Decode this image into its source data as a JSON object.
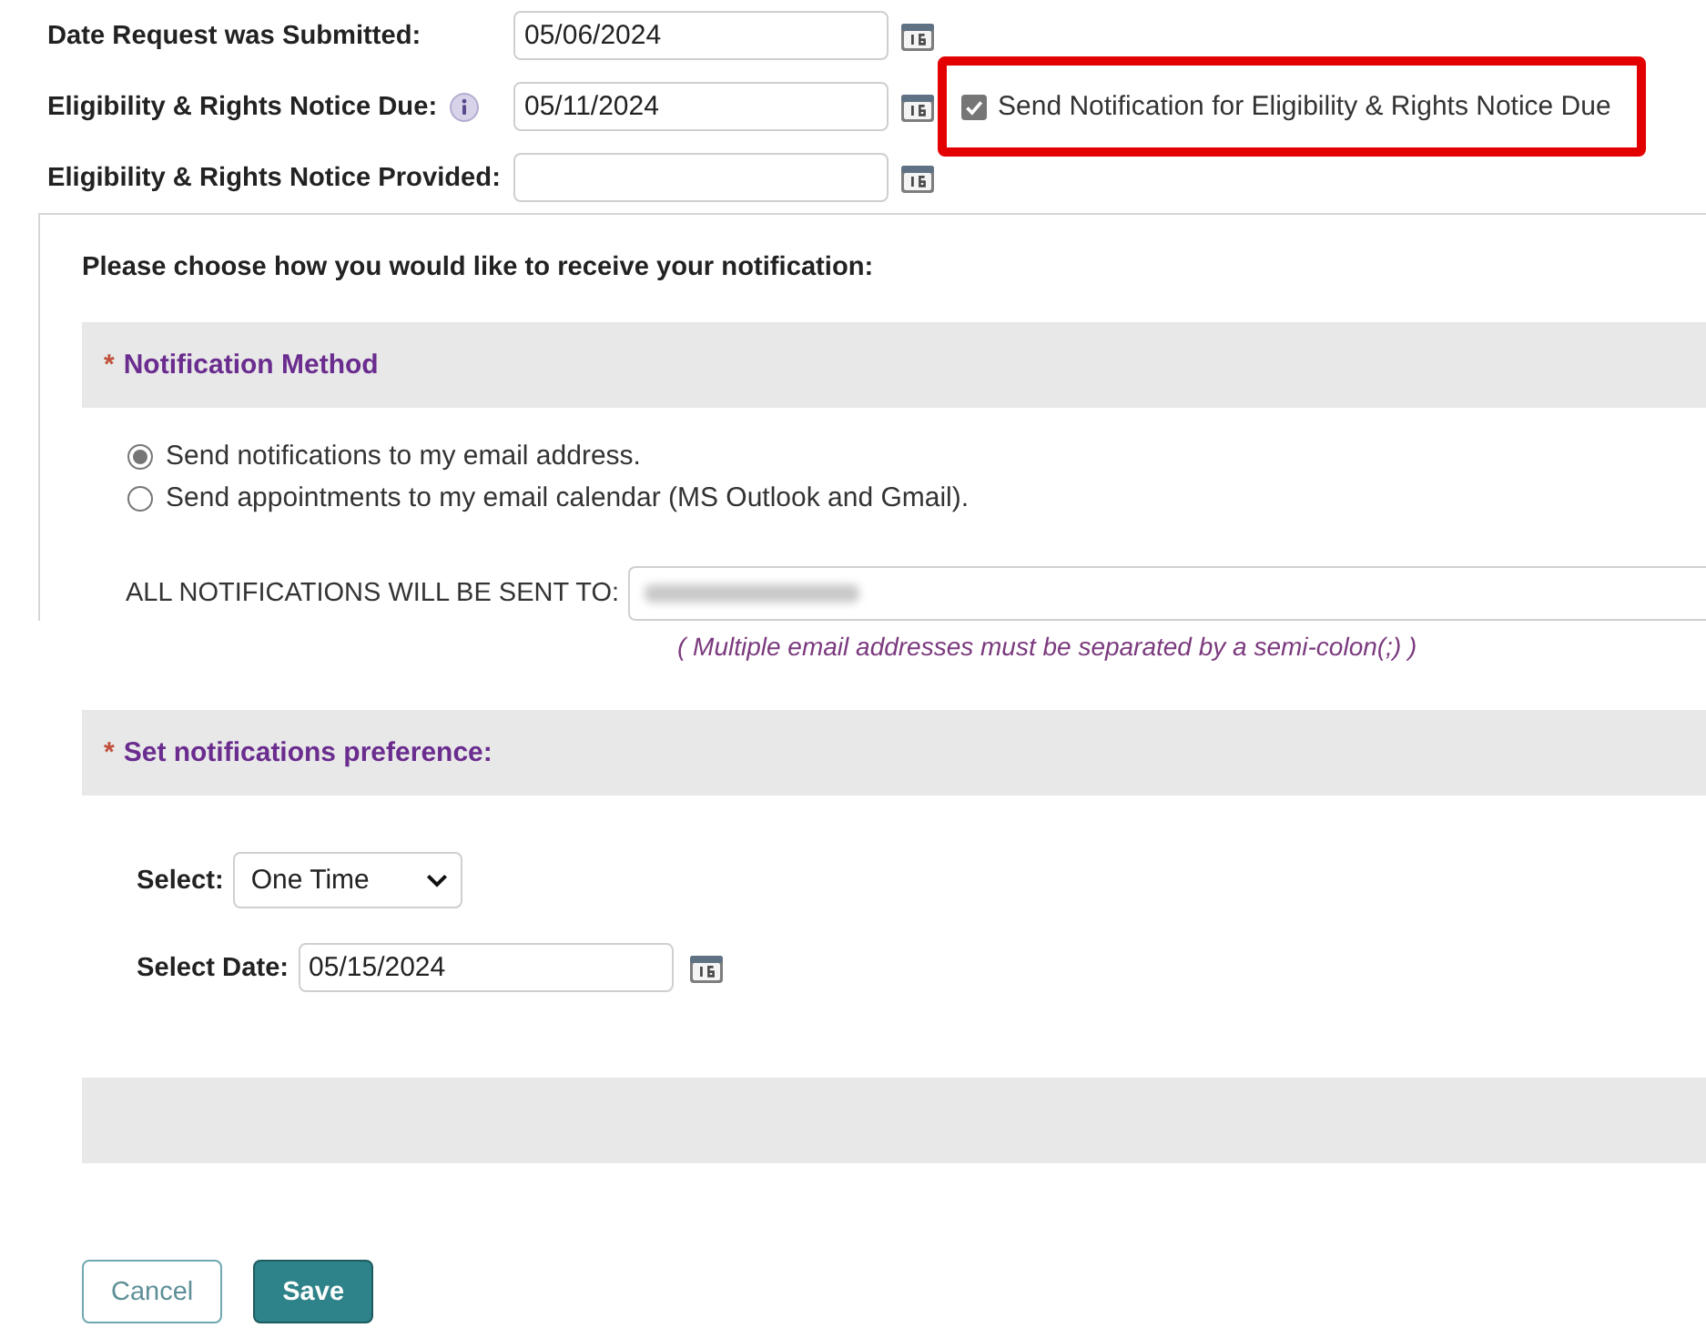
{
  "date_fields": [
    {
      "label": "Date Request was Submitted:",
      "value": "05/06/2024",
      "info": false
    },
    {
      "label": "Eligibility & Rights Notice Due:",
      "value": "05/11/2024",
      "info": true
    },
    {
      "label": "Eligibility & Rights Notice Provided:",
      "info": false
    }
  ],
  "notification_checkbox": {
    "label": "Send Notification for Eligibility & Rights Notice Due",
    "checked": true,
    "highlighted": true
  },
  "prompt": "Please choose how you would like to receive your notification:",
  "method_section": {
    "marker": "*",
    "title": "Notification Method"
  },
  "methods": [
    {
      "label": "Send notifications to my email address.",
      "selected": true
    },
    {
      "label": "Send appointments to my email calendar (MS Outlook and Gmail).",
      "selected": false
    }
  ],
  "recipient": {
    "label": "ALL NOTIFICATIONS WILL BE SENT TO:",
    "value_redacted": true,
    "hint": "( Multiple email addresses must be separated by a semi-colon(;) )"
  },
  "preference_section": {
    "marker": "*",
    "title": "Set notifications preference:"
  },
  "frequency": {
    "label": "Select:",
    "value": "One Time"
  },
  "select_date": {
    "label": "Select Date:",
    "value": "05/15/2024"
  },
  "buttons": [
    {
      "label": "Cancel",
      "kind": "secondary"
    },
    {
      "label": "Save",
      "kind": "primary"
    }
  ]
}
